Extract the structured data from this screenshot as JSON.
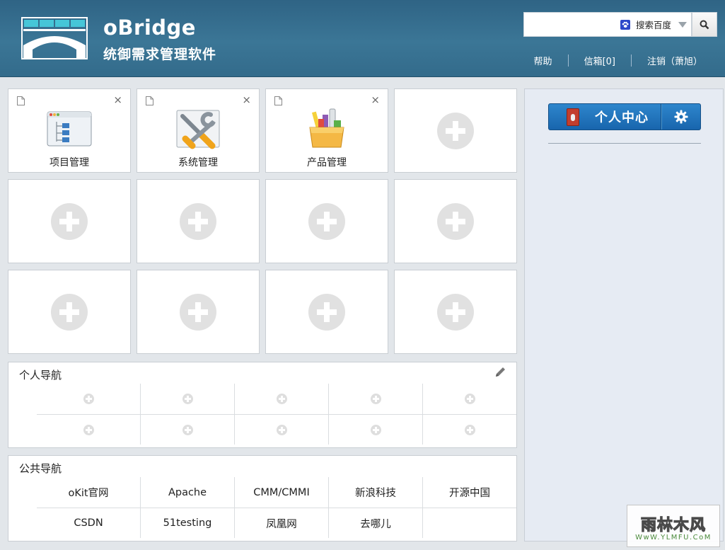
{
  "header": {
    "brand_name": "oBridge",
    "brand_subtitle": "统御需求管理软件",
    "search": {
      "value": "",
      "engine_label": "搜索百度",
      "button_icon": "search-icon"
    },
    "links": {
      "help": "帮助",
      "inbox": "信箱[0]",
      "logout": "注销（萧旭）"
    }
  },
  "tiles": [
    {
      "label": "项目管理",
      "icon": "project-window-icon"
    },
    {
      "label": "系统管理",
      "icon": "tools-icon"
    },
    {
      "label": "产品管理",
      "icon": "product-box-icon"
    }
  ],
  "personal_nav": {
    "title": "个人导航"
  },
  "public_nav": {
    "title": "公共导航",
    "links": [
      "oKit官网",
      "Apache",
      "CMM/CMMI",
      "新浪科技",
      "开源中国",
      "CSDN",
      "51testing",
      "凤凰网",
      "去哪儿",
      ""
    ]
  },
  "right_panel": {
    "personal_center_label": "个人中心"
  },
  "watermark": {
    "text": "雨林木风",
    "url": "WwW.YLMFU.CoM"
  },
  "colors": {
    "header": "#336b8b",
    "accent_button": "#1e74bc",
    "page_bg": "#e2e6ea",
    "tile_plus": "#e1e1e1"
  }
}
